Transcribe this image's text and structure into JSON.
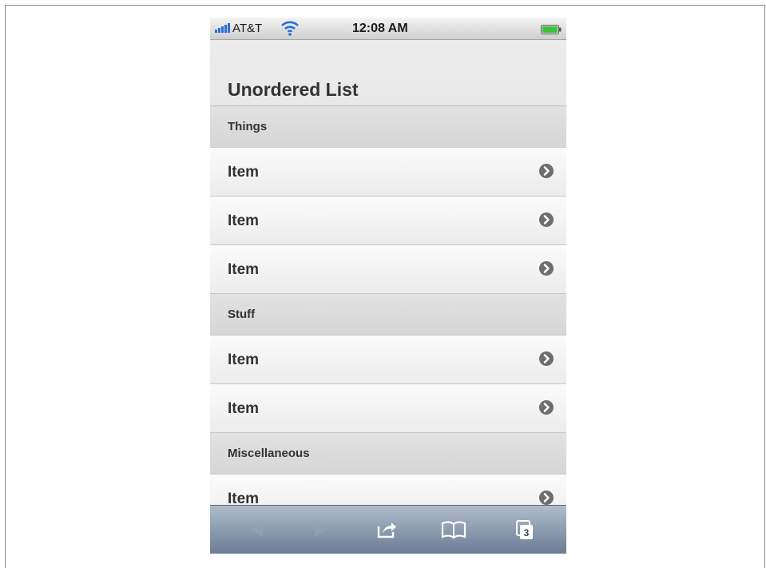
{
  "status_bar": {
    "carrier": "AT&T",
    "time": "12:08 AM",
    "signal_icon": "signal-bars-icon",
    "wifi_icon": "wifi-icon",
    "battery_icon": "battery-icon"
  },
  "page": {
    "title": "Unordered List"
  },
  "list": {
    "sections": [
      {
        "title": "Things",
        "items": [
          "Item",
          "Item",
          "Item"
        ]
      },
      {
        "title": "Stuff",
        "items": [
          "Item",
          "Item"
        ]
      },
      {
        "title": "Miscellaneous",
        "items": [
          "Item"
        ]
      }
    ]
  },
  "toolbar": {
    "buttons": [
      "back-arrow-icon",
      "forward-arrow-icon",
      "share-icon",
      "bookmarks-icon",
      "pages-icon"
    ],
    "pages_count": "3"
  },
  "colors": {
    "toolbar": "#7f8ea5",
    "signal": "#2a6fd6",
    "battery": "#3ac23a"
  }
}
